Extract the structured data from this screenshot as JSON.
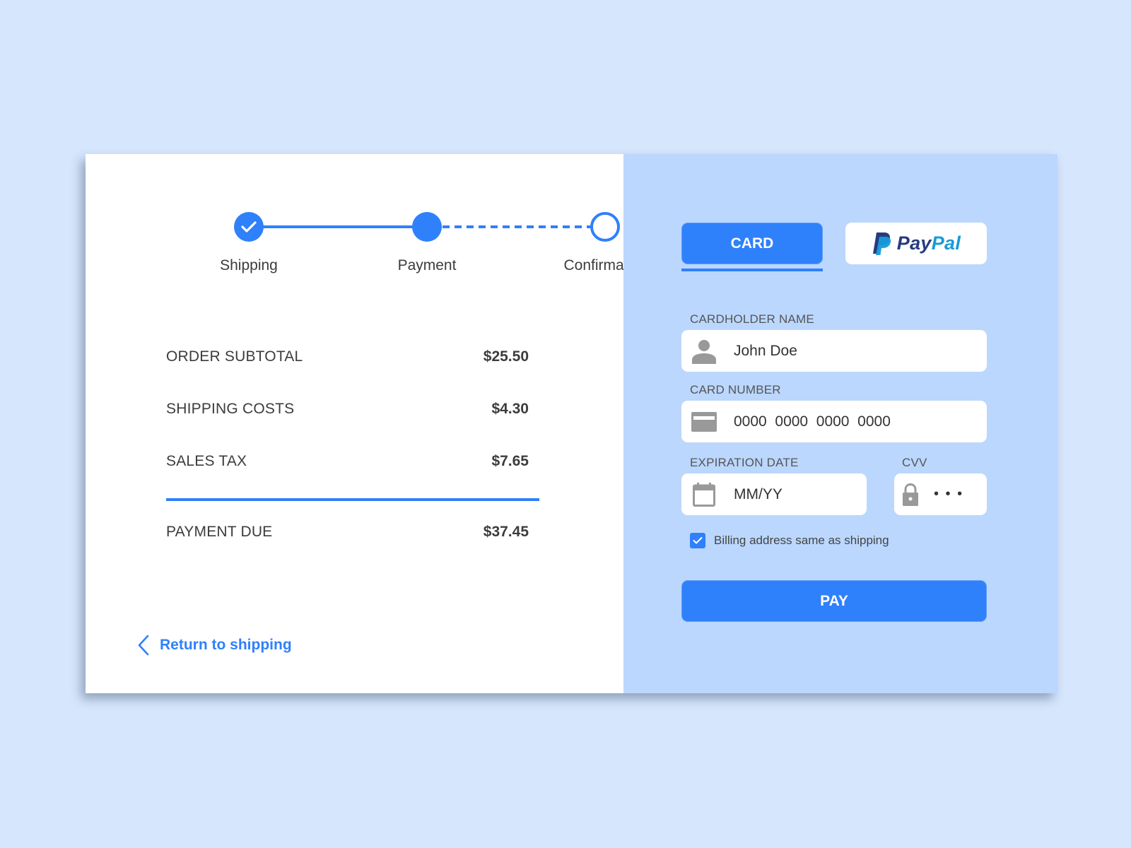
{
  "stepper": {
    "steps": [
      {
        "label": "Shipping",
        "state": "completed"
      },
      {
        "label": "Payment",
        "state": "current"
      },
      {
        "label": "Confirmation",
        "state": "upcoming"
      }
    ]
  },
  "summary": {
    "rows": [
      {
        "label": "ORDER SUBTOTAL",
        "value": "$25.50"
      },
      {
        "label": "SHIPPING COSTS",
        "value": "$4.30"
      },
      {
        "label": "SALES TAX",
        "value": "$7.65"
      }
    ],
    "total": {
      "label": "PAYMENT DUE",
      "value": "$37.45"
    }
  },
  "back_link": {
    "label": "Return to shipping",
    "icon": "chevron-left-icon"
  },
  "payment_tabs": {
    "card_label": "CARD",
    "paypal_pay": "Pay",
    "paypal_pal": "Pal",
    "selected": "card"
  },
  "form": {
    "cardholder": {
      "label": "CARDHOLDER NAME",
      "value": "John Doe",
      "icon": "user-icon"
    },
    "card_number": {
      "label": "CARD NUMBER",
      "placeholder": "0000  0000  0000  0000",
      "icon": "credit-card-icon"
    },
    "expiration": {
      "label": "EXPIRATION DATE",
      "placeholder": "MM/YY",
      "icon": "calendar-icon"
    },
    "cvv": {
      "label": "CVV",
      "placeholder": "• • •",
      "icon": "lock-icon"
    },
    "billing_same": {
      "label": "Billing address same as shipping",
      "checked": true
    }
  },
  "pay_button": {
    "label": "PAY"
  },
  "colors": {
    "accent": "#2f80fb",
    "panel": "#bbd7fe",
    "background": "#d6e6fd",
    "paypal_dark": "#253b80",
    "paypal_light": "#179bd7"
  }
}
